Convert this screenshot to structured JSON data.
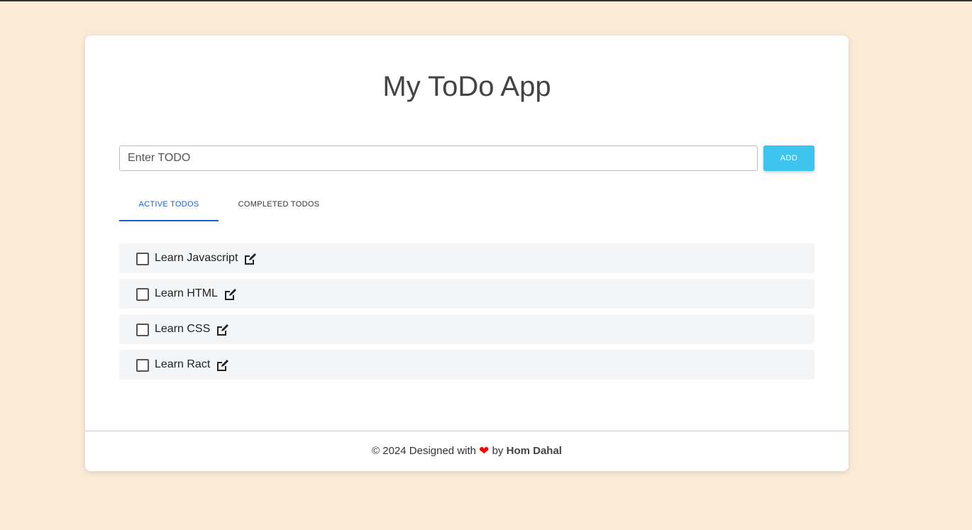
{
  "app": {
    "title": "My ToDo App"
  },
  "form": {
    "input_placeholder": "Enter TODO",
    "input_value": "",
    "add_label": "ADD"
  },
  "tabs": [
    {
      "label": "ACTIVE TODOS",
      "active": true
    },
    {
      "label": "COMPLETED TODOS",
      "active": false
    }
  ],
  "todos": [
    {
      "label": "Learn Javascript",
      "checked": false
    },
    {
      "label": "Learn HTML",
      "checked": false
    },
    {
      "label": "Learn CSS",
      "checked": false
    },
    {
      "label": "Learn Ract",
      "checked": false
    }
  ],
  "footer": {
    "prefix": "© 2024 Designed with",
    "by": "by",
    "author": "Hom Dahal",
    "heart_icon": "heart-icon"
  },
  "colors": {
    "background": "#FAEBD7",
    "accent": "#1a5fd0",
    "add_button": "#3ec5ef",
    "heart": "#ff0000"
  }
}
